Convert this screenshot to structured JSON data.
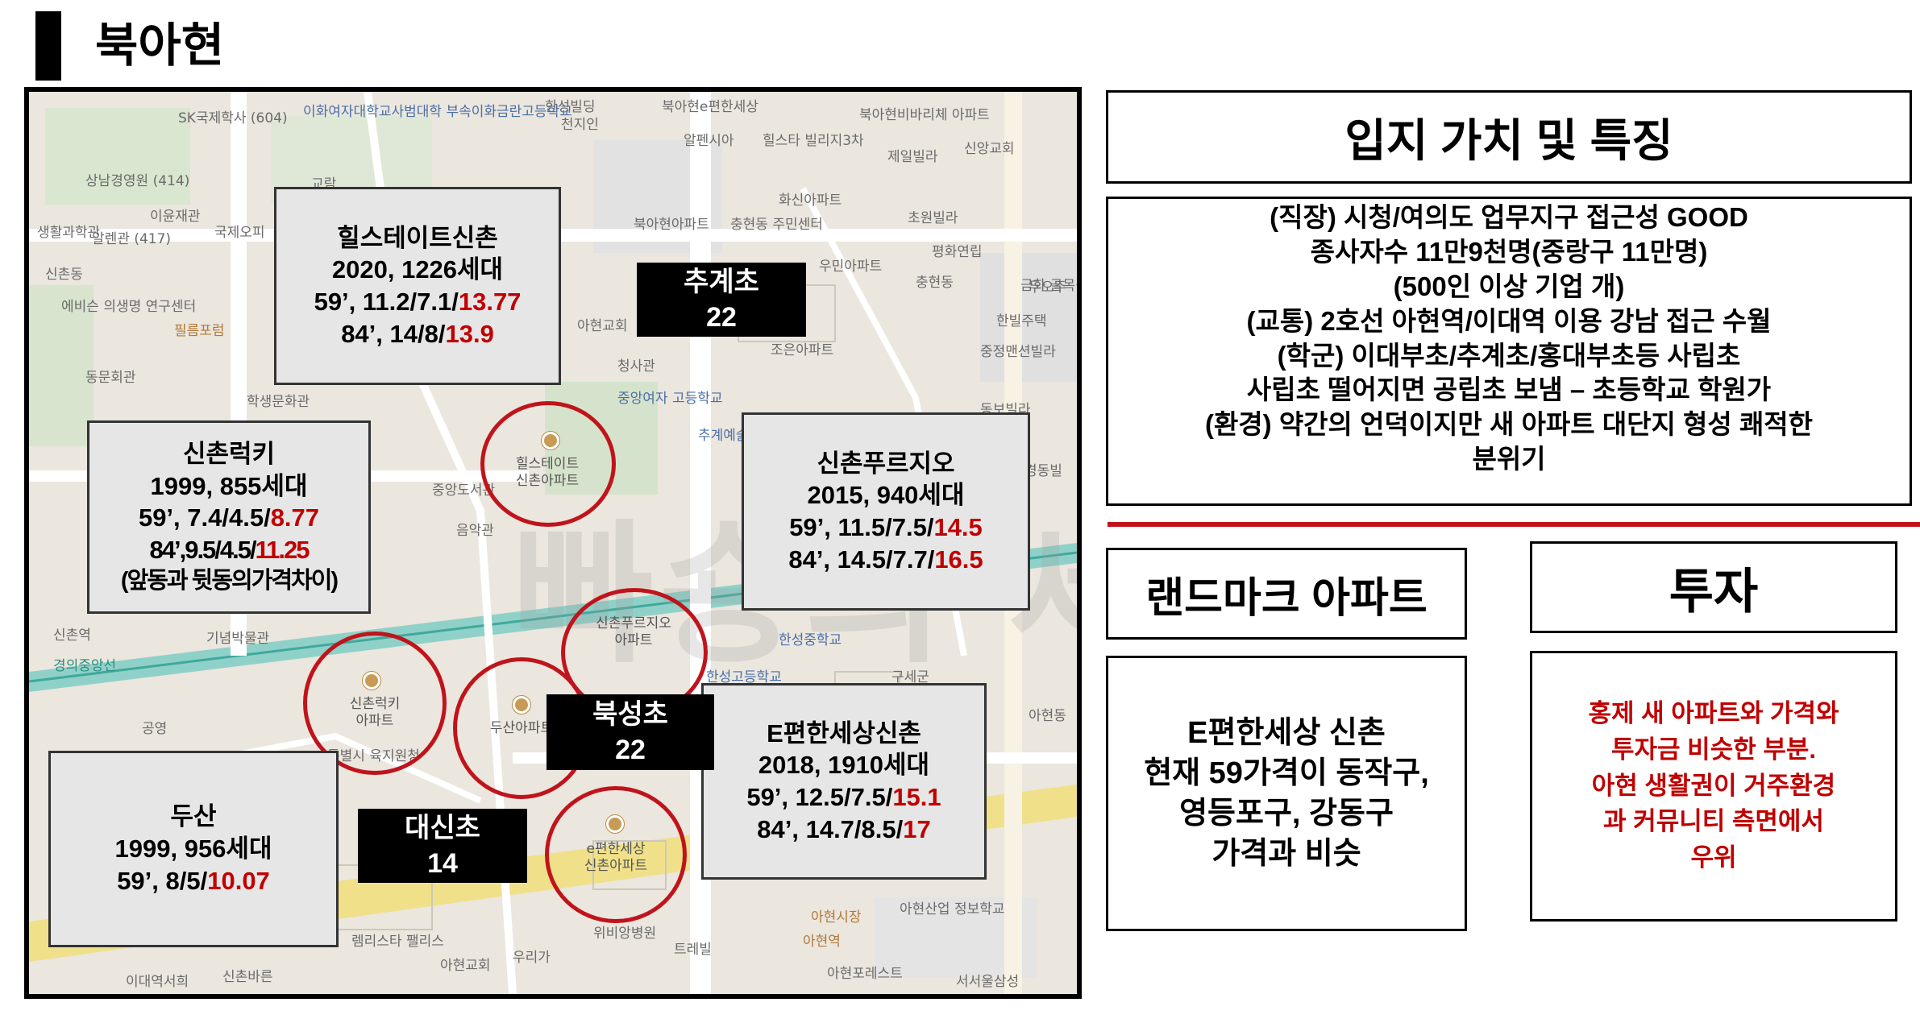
{
  "page": {
    "title": "북아현"
  },
  "map": {
    "watermark": "빠숑의 세상 답사기",
    "labels": [
      "SK국제학사 (604)",
      "이화여자대학교사범대학 부속이화금란고등학교",
      "한성빌딩",
      "천지인",
      "북아현e편한세상",
      "북아현비바리체 아파트",
      "신앙교회",
      "알펜시아",
      "힐스타 빌리지3차",
      "제일빌라",
      "상남경영원 (414)",
      "이윤재관",
      "국제오피",
      "알렌관 (417)",
      "생활과학관",
      "신촌동",
      "에비슨 의생명 연구센터",
      "필름포럼",
      "동문회관",
      "학생문화관",
      "교람",
      "북아현아파트",
      "충현동 주민센터",
      "화신아파트",
      "초원빌라",
      "평화연립",
      "충현동",
      "우민아파트",
      "아현교회",
      "한빌주택",
      "중정맨션빌라",
      "청사관",
      "조은아파트",
      "금화 골목길",
      "두오주",
      "동보빌라",
      "중앙여자 고등학교",
      "추계예술 대학교",
      "중앙도서관",
      "음악관",
      "경동빌",
      "신촌역",
      "기념박물관",
      "경의중앙선",
      "한성중학교",
      "한성고등학교",
      "구세군",
      "공영",
      "특별시 육지원청",
      "아현동",
      "아현산업 정보학교",
      "위비앙병원",
      "아현시장",
      "트레빌",
      "렘리스타 팰리스",
      "아현교회",
      "우리가",
      "이대역서희",
      "신촌바른",
      "서서울삼성",
      "아현역",
      "아현포레스트"
    ],
    "pins": [
      {
        "label": "힐스테이트\n신촌아파트"
      },
      {
        "label": "신촌푸르지오\n아파트"
      },
      {
        "label": "신촌럭키\n아파트"
      },
      {
        "label": "두산아파트"
      },
      {
        "label": "e편한세상\n신촌아파트"
      }
    ]
  },
  "apartments": [
    {
      "id": "hillstate",
      "name": "힐스테이트신촌",
      "info": "2020, 1226세대",
      "l1": "59’, 11.2/7.1/",
      "r1": "13.77",
      "l2": "84’, 14/8/",
      "r2": "13.9"
    },
    {
      "id": "lucky",
      "name": "신촌럭키",
      "info": "1999, 855세대",
      "l1": "59’, 7.4/4.5/",
      "r1": "8.77",
      "l2": "84’,9.5/4.5/",
      "r2": "11.25",
      "note": "(앞동과 뒷동의가격차이)"
    },
    {
      "id": "prugio",
      "name": "신촌푸르지오",
      "info": "2015, 940세대",
      "l1": "59’, 11.5/7.5/",
      "r1": "14.5",
      "l2": "84’, 14.5/7.7/",
      "r2": "16.5"
    },
    {
      "id": "epyunhan",
      "name": "E편한세상신촌",
      "info": "2018, 1910세대",
      "l1": "59’, 12.5/7.5/",
      "r1": "15.1",
      "l2": "84’, 14.7/8.5/",
      "r2": "17"
    },
    {
      "id": "doosan",
      "name": "두산",
      "info": "1999, 956세대",
      "l1": "59’, 8/5/",
      "r1": "10.07"
    }
  ],
  "schools": [
    {
      "name": "추계초",
      "count": "22"
    },
    {
      "name": "북성초",
      "count": "22"
    },
    {
      "name": "대신초",
      "count": "14"
    }
  ],
  "features": {
    "heading": "입지 가치 및 특징",
    "lines": [
      "(직장) 시청/여의도 업무지구 접근성 GOOD",
      "종사자수 11만9천명(중랑구 11만명)",
      "(500인 이상 기업 개)",
      "(교통) 2호선 아현역/이대역 이용 강남 접근 수월",
      "(학군) 이대부초/추계초/홍대부초등 사립초",
      "사립초 떨어지면 공립초 보냄 – 초등학교 학원가",
      "(환경) 약간의 언덕이지만 새 아파트 대단지 형성 쾌적한",
      "분위기"
    ]
  },
  "landmark": {
    "heading": "랜드마크 아파트",
    "lines": [
      "E편한세상 신촌",
      "현재 59가격이 동작구,",
      "영등포구, 강동구",
      "가격과 비슷"
    ]
  },
  "investment": {
    "heading": "투자",
    "lines": [
      "홍제 새 아파트와 가격와",
      "투자금 비슷한 부분.",
      "아현 생활권이 거주환경",
      "과 커뮤니티 측면에서",
      "우위"
    ]
  },
  "colors": {
    "accent_red": "#c00000",
    "circle_red": "#c0141c"
  }
}
